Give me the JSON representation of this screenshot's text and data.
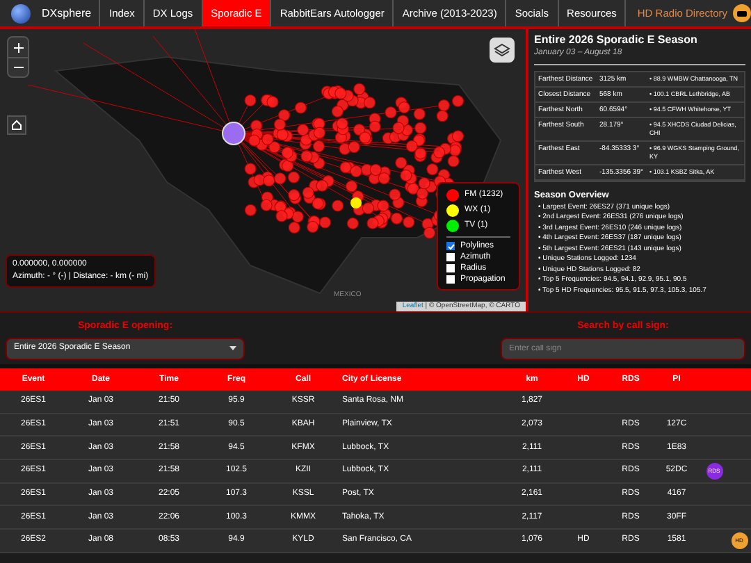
{
  "nav": {
    "brand": "DXsphere",
    "items": [
      {
        "label": "Index",
        "selected": false
      },
      {
        "label": "DX Logs",
        "selected": false
      },
      {
        "label": "Sporadic E",
        "selected": true
      },
      {
        "label": "RabbitEars Autologger",
        "selected": false
      },
      {
        "label": "Archive (2013-2023)",
        "selected": false
      },
      {
        "label": "Socials",
        "selected": false
      },
      {
        "label": "Resources",
        "selected": false
      }
    ],
    "hd_link": "HD Radio Directory"
  },
  "map": {
    "coords": "0.000000, 0.000000",
    "azimuth": "Azimuth: - ° (-) | Distance: - km (- mi)",
    "country_label": "MEXICO",
    "attribution": {
      "leaflet": "Leaflet",
      "rest": "| © OpenStreetMap, © CARTO"
    },
    "legend": [
      {
        "label": "FM (1232)",
        "color": "#ff0000"
      },
      {
        "label": "WX (1)",
        "color": "#ffff00"
      },
      {
        "label": "TV (1)",
        "color": "#00ee00"
      }
    ],
    "layers": [
      {
        "label": "Polylines",
        "checked": true
      },
      {
        "label": "Azimuth",
        "checked": false
      },
      {
        "label": "Radius",
        "checked": false
      },
      {
        "label": "Propagation",
        "checked": false
      }
    ]
  },
  "panel": {
    "title": "Entire 2026 Sporadic E Season",
    "subtitle": "January 03 – August 18",
    "records": [
      {
        "label": "Farthest Distance",
        "value": "3125 km",
        "station": "• 88.9 WMBW Chattanooga, TN"
      },
      {
        "label": "Closest Distance",
        "value": "568 km",
        "station": "• 100.1 CBRL Lethbridge, AB"
      },
      {
        "label": "Farthest North",
        "value": "60.6594°",
        "station": "• 94.5 CFWH Whitehorse, YT"
      },
      {
        "label": "Farthest South",
        "value": "28.179°",
        "station": "• 94.5 XHCDS Ciudad Delicias, CHI"
      },
      {
        "label": "Farthest East",
        "value": "-84.35333 3°",
        "station": "• 96.9 WGKS Stamping Ground, KY"
      },
      {
        "label": "Farthest West",
        "value": "-135.3356 39°",
        "station": "• 103.1 KSBZ Sitka, AK"
      }
    ],
    "overview_title": "Season Overview",
    "overview": [
      "• Largest Event: 26ES27 (371 unique logs)",
      "• 2nd Largest Event: 26ES31 (276 unique logs)",
      "• 3rd Largest Event: 26ES10 (246 unique logs)",
      "• 4th Largest Event: 26ES37 (187 unique logs)",
      "• 5th Largest Event: 26ES21 (143 unique logs)",
      "• Unique Stations Logged: 1234",
      "• Unique HD Stations Logged: 82",
      "• Top 5 Frequencies: 94.5, 94.1, 92.9, 95.1, 90.5",
      "• Top 5 HD Frequencies: 95.5, 91.5, 97.3, 105.3, 105.7"
    ]
  },
  "opening": {
    "label": "Sporadic E opening:",
    "value": "Entire 2026 Sporadic E Season"
  },
  "search": {
    "label": "Search by call sign:",
    "placeholder": "Enter call sign"
  },
  "table": {
    "columns": [
      "Event",
      "Date",
      "Time",
      "Freq",
      "Call",
      "City of License",
      "km",
      "HD",
      "RDS",
      "PI"
    ],
    "rows": [
      {
        "cells": [
          "26ES1",
          "Jan 03",
          "21:50",
          "95.9",
          "KSSR",
          "Santa Rosa, NM",
          "1,827",
          "",
          "",
          ""
        ]
      },
      {
        "cells": [
          "26ES1",
          "Jan 03",
          "21:51",
          "90.5",
          "KBAH",
          "Plainview, TX",
          "2,073",
          "",
          "RDS",
          "127C"
        ]
      },
      {
        "cells": [
          "26ES1",
          "Jan 03",
          "21:58",
          "94.5",
          "KFMX",
          "Lubbock, TX",
          "2,111",
          "",
          "RDS",
          "1E83"
        ]
      },
      {
        "cells": [
          "26ES1",
          "Jan 03",
          "21:58",
          "102.5",
          "KZII",
          "Lubbock, TX",
          "2,111",
          "",
          "RDS",
          "52DC"
        ],
        "badge": {
          "kind": "rds",
          "label": "RDS"
        }
      },
      {
        "cells": [
          "26ES1",
          "Jan 03",
          "22:05",
          "107.3",
          "KSSL",
          "Post, TX",
          "2,161",
          "",
          "RDS",
          "4167"
        ]
      },
      {
        "cells": [
          "26ES1",
          "Jan 03",
          "22:06",
          "100.3",
          "KMMX",
          "Tahoka, TX",
          "2,117",
          "",
          "RDS",
          "30FF"
        ]
      },
      {
        "cells": [
          "26ES2",
          "Jan 08",
          "08:53",
          "94.9",
          "KYLD",
          "San Francisco, CA",
          "1,076",
          "HD",
          "RDS",
          "1581"
        ],
        "badge": {
          "kind": "hd",
          "label": "HD"
        }
      }
    ]
  }
}
